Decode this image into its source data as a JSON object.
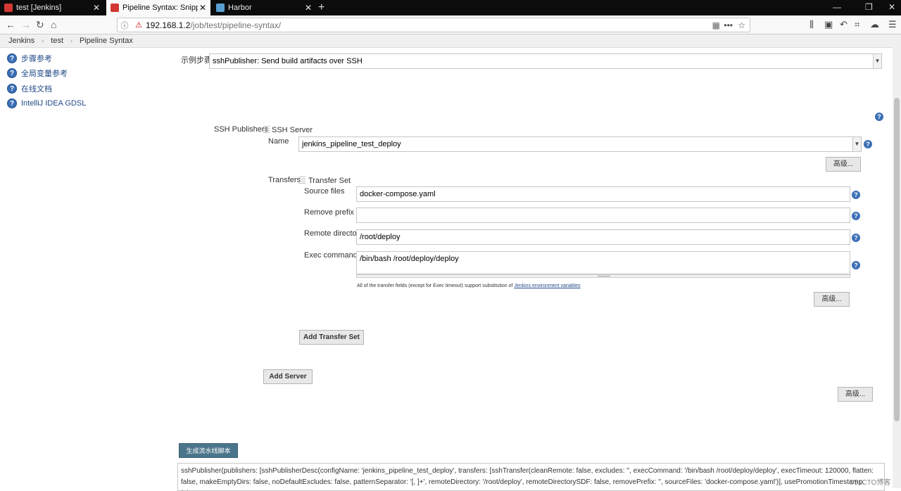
{
  "browser": {
    "tabs": [
      {
        "label": "test [Jenkins]",
        "active": false
      },
      {
        "label": "Pipeline Syntax: Snippet Gen",
        "active": true
      },
      {
        "label": "Harbor",
        "active": false
      }
    ],
    "url_host": "192.168.1.2",
    "url_path": "/job/test/pipeline-syntax/"
  },
  "breadcrumb": [
    "Jenkins",
    "test",
    "Pipeline Syntax"
  ],
  "sidebar": {
    "items": [
      {
        "label": "步骤参考"
      },
      {
        "label": "全局变量参考"
      },
      {
        "label": "在线文档"
      },
      {
        "label": "IntelliJ IDEA GDSL"
      }
    ]
  },
  "form": {
    "sample_step_label": "示例步骤",
    "sample_step_value": "sshPublisher: Send build artifacts over SSH",
    "ssh_publishers_label": "SSH Publishers",
    "ssh_server_label": "SSH Server",
    "name_label": "Name",
    "name_value": "jenkins_pipeline_test_deploy",
    "advanced_label": "高级...",
    "transfers_label": "Transfers",
    "transfer_set_label": "Transfer Set",
    "source_files_label": "Source files",
    "source_files_value": "docker-compose.yaml",
    "remove_prefix_label": "Remove prefix",
    "remove_prefix_value": "",
    "remote_directory_label": "Remote directory",
    "remote_directory_value": "/root/deploy",
    "exec_command_label": "Exec command",
    "exec_command_value": "/bin/bash /root/deploy/deploy",
    "hint_text": "All of the transfer fields (except for Exec timeout) support substitution of ",
    "hint_link": "Jenkins environment variables",
    "add_transfer_set": "Add Transfer Set",
    "add_server": "Add Server",
    "generate_button": "生成流水线脚本",
    "output": "sshPublisher(publishers: [sshPublisherDesc(configName: 'jenkins_pipeline_test_deploy', transfers: [sshTransfer(cleanRemote: false, excludes: '', execCommand: '/bin/bash /root/deploy/deploy', execTimeout: 120000, flatten: false, makeEmptyDirs: false, noDefaultExcludes: false, patternSeparator: '[, ]+', remoteDirectory: '/root/deploy', remoteDirectorySDF: false, removePrefix: '', sourceFiles: 'docker-compose.yaml')], usePromotionTimestamp: false,"
  },
  "watermark": "©51CTO博客",
  "colors": {
    "accent": "#4b758b",
    "link": "#204a87",
    "help": "#3b6fb6"
  }
}
